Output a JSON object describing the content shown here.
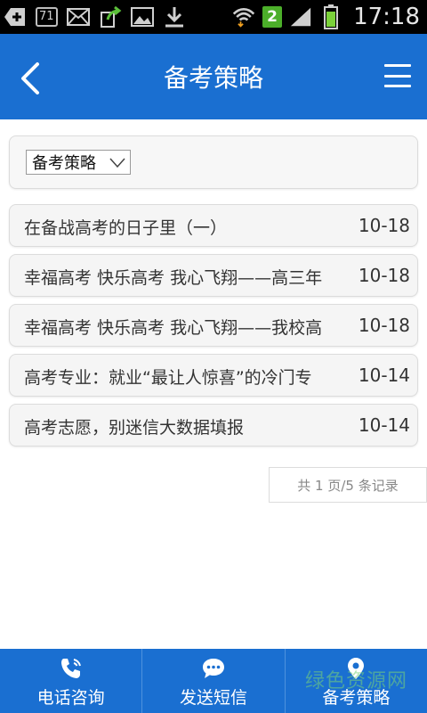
{
  "status_bar": {
    "badge_count": "71",
    "notification_count": "2",
    "time": "17:18"
  },
  "header": {
    "title": "备考策略"
  },
  "filter": {
    "selected": "备考策略"
  },
  "articles": [
    {
      "title": "在备战高考的日子里（一）",
      "date": "10-18"
    },
    {
      "title": "幸福高考 快乐高考 我心飞翔——高三年",
      "date": "10-18"
    },
    {
      "title": "幸福高考 快乐高考 我心飞翔——我校高",
      "date": "10-18"
    },
    {
      "title": "高考专业：就业“最让人惊喜”的冷门专",
      "date": "10-14"
    },
    {
      "title": "高考志愿，别迷信大数据填报",
      "date": "10-14"
    }
  ],
  "pager": {
    "text": "共 1 页/5 条记录"
  },
  "bottom_nav": {
    "items": [
      {
        "label": "电话咨询",
        "icon": "phone-icon"
      },
      {
        "label": "发送短信",
        "icon": "message-icon"
      },
      {
        "label": "备考策略",
        "icon": "location-pin-icon"
      }
    ]
  },
  "watermark": "绿色资源网",
  "colors": {
    "primary": "#1a6fd1",
    "status_green": "#4caf2a"
  }
}
